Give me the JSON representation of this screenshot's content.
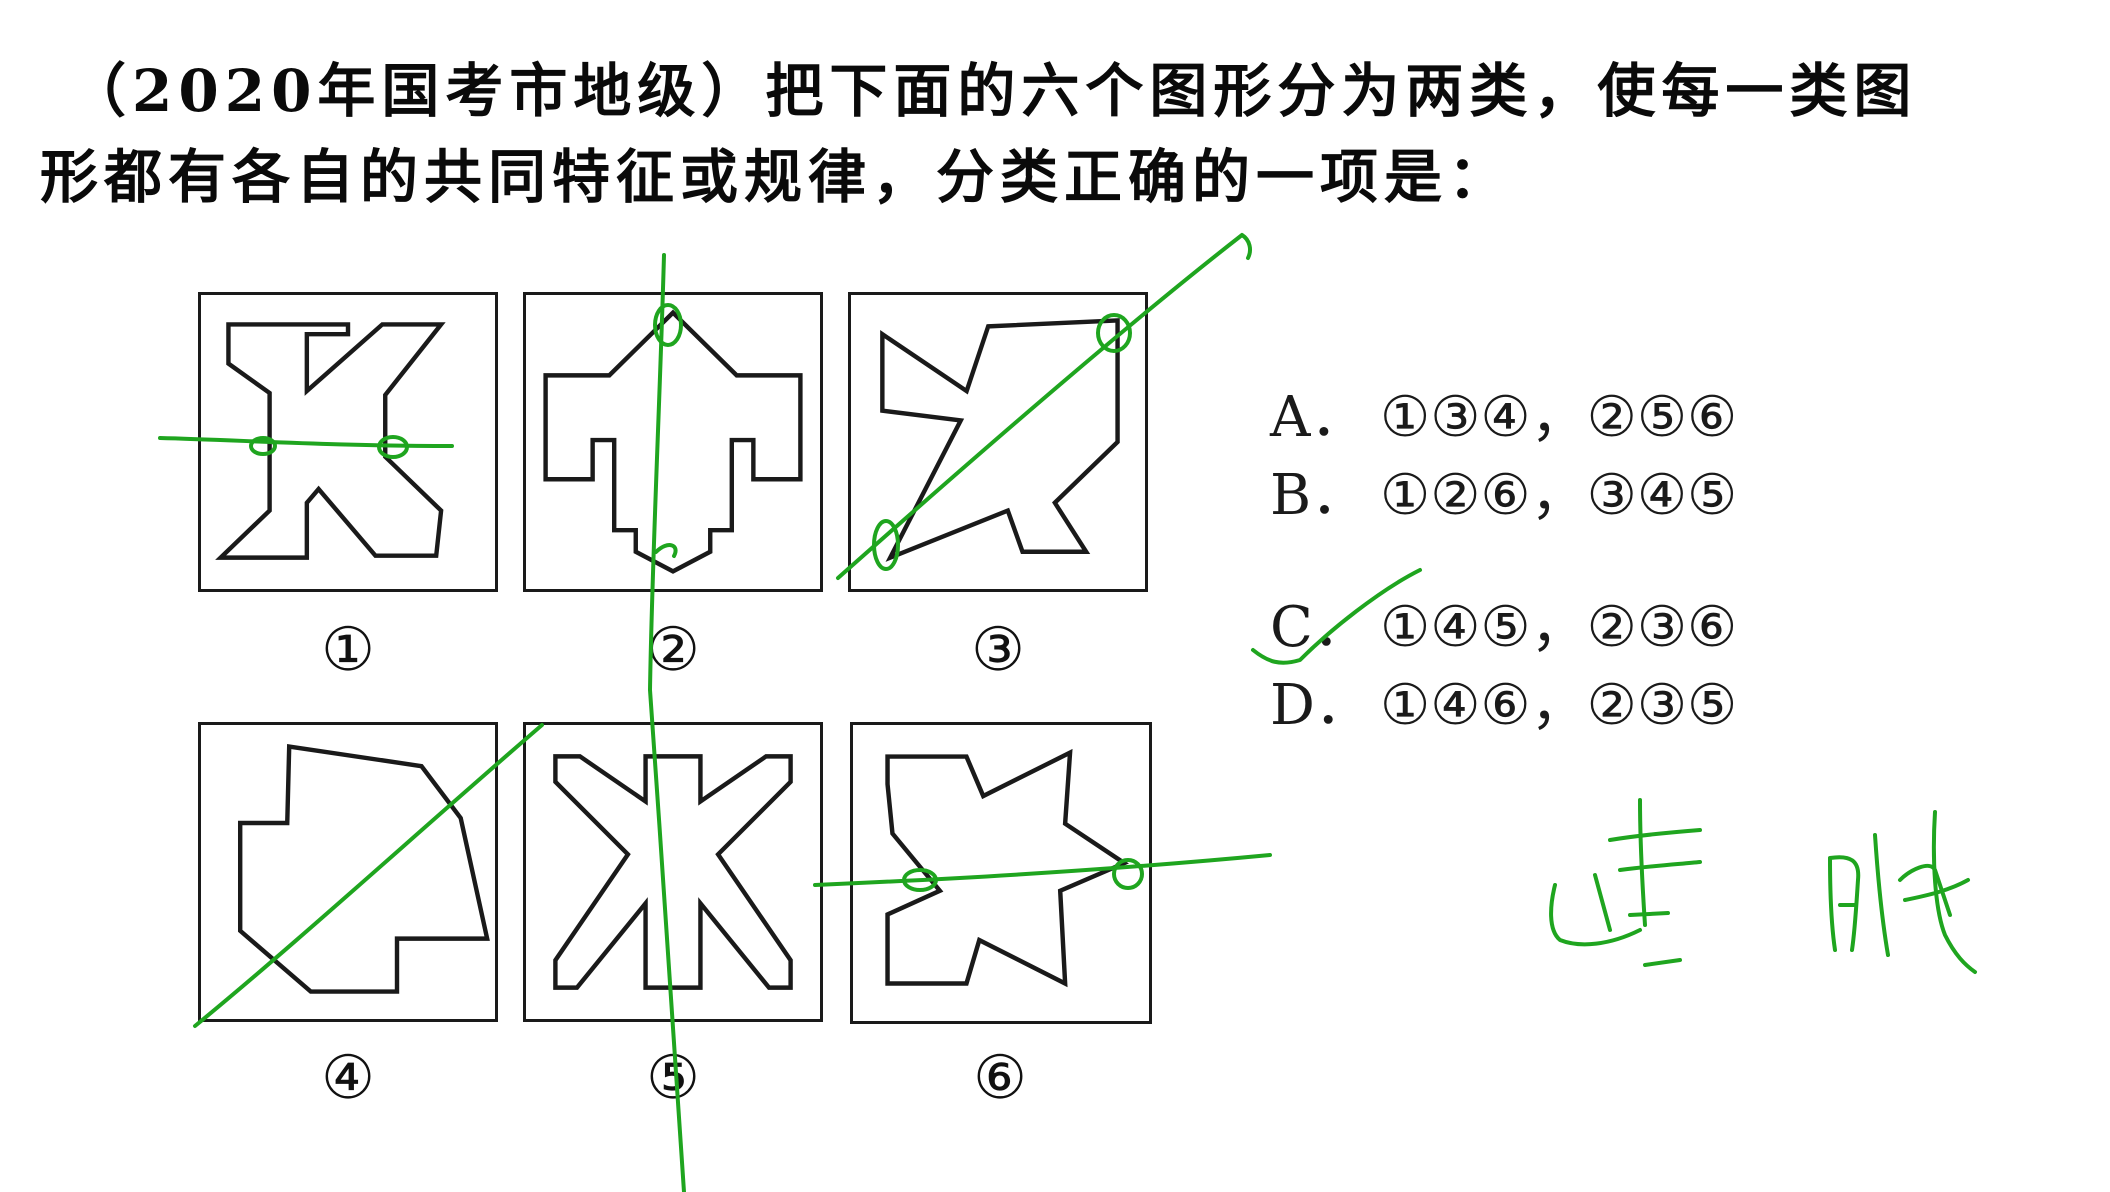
{
  "question": {
    "line1": "（2020年国考市地级）把下面的六个图形分为两类，使每一类图",
    "line2": "形都有各自的共同特征或规律，分类正确的一项是："
  },
  "figures": [
    {
      "label": "①"
    },
    {
      "label": "②"
    },
    {
      "label": "③"
    },
    {
      "label": "④"
    },
    {
      "label": "⑤"
    },
    {
      "label": "⑥"
    }
  ],
  "options": [
    {
      "key": "A．",
      "text": "①③④，②⑤⑥"
    },
    {
      "key": "B．",
      "text": "①②⑥，③④⑤"
    },
    {
      "key": "C．",
      "text": "①④⑤，②③⑥"
    },
    {
      "key": "D．",
      "text": "①④⑥，②③⑤"
    }
  ],
  "annotation": {
    "ink_color": "#1fa51f",
    "handwriting_left": "",
    "handwriting_right": ""
  }
}
